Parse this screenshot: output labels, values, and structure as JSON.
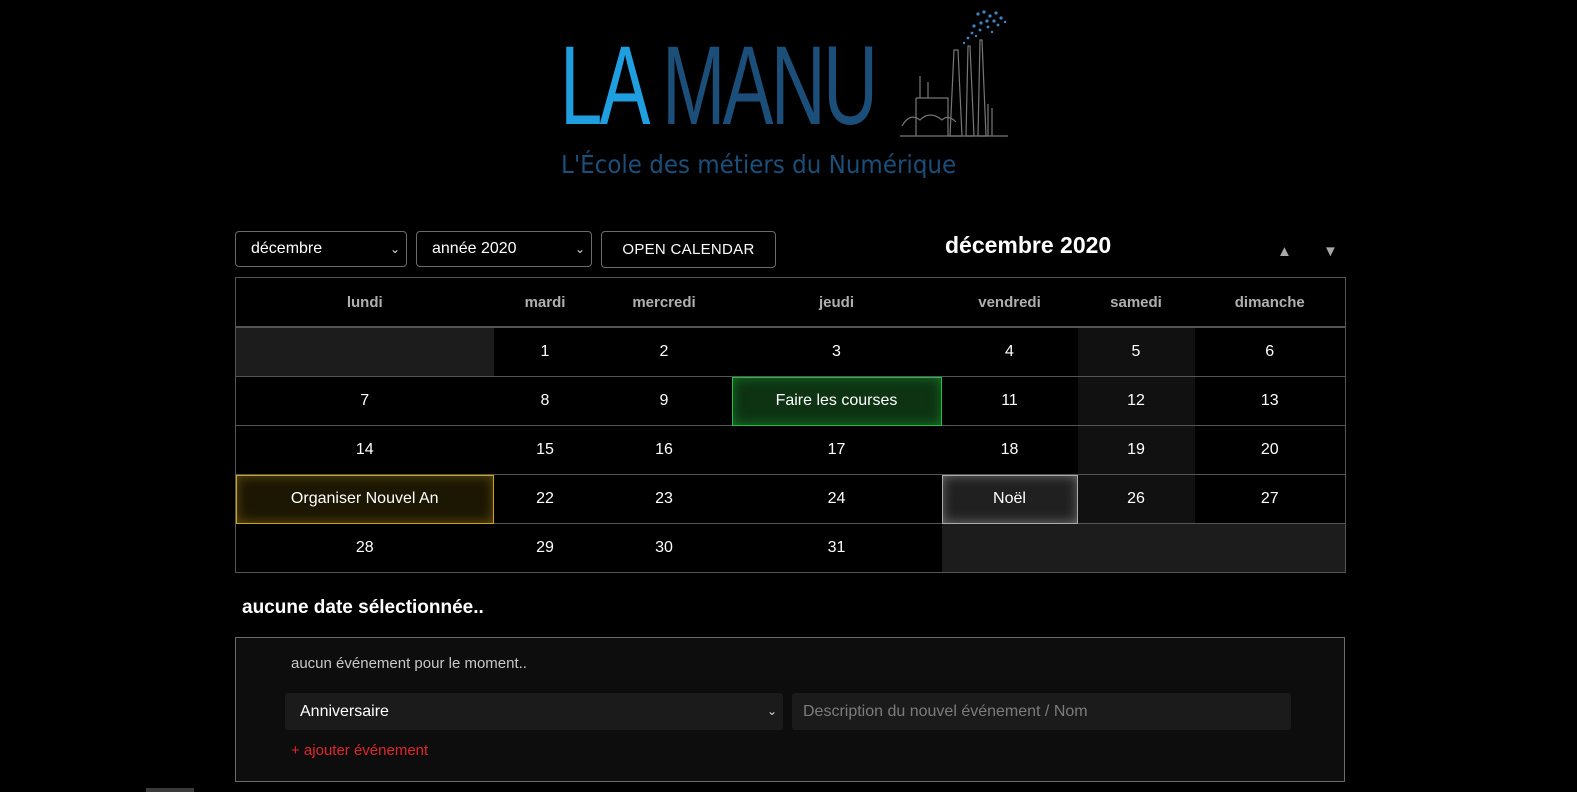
{
  "logo": {
    "title_part1": "LA",
    "title_part2": "MANU",
    "subtitle": "L'École des métiers du Numérique",
    "icon": "factory-icon"
  },
  "toolbar": {
    "month_select": "décembre",
    "year_select": "année 2020",
    "open_calendar_label": "OPEN CALENDAR",
    "month_title": "décembre 2020",
    "prev_icon": "triangle-up-icon",
    "next_icon": "triangle-down-icon"
  },
  "calendar": {
    "weekdays": [
      "lundi",
      "mardi",
      "mercredi",
      "jeudi",
      "vendredi",
      "samedi",
      "dimanche"
    ],
    "weeks": [
      [
        "",
        "1",
        "2",
        "3",
        "4",
        "5",
        "6"
      ],
      [
        "7",
        "8",
        "9",
        "Faire les courses",
        "11",
        "12",
        "13"
      ],
      [
        "14",
        "15",
        "16",
        "17",
        "18",
        "19",
        "20"
      ],
      [
        "Organiser Nouvel An",
        "22",
        "23",
        "24",
        "Noël",
        "26",
        "27"
      ],
      [
        "28",
        "29",
        "30",
        "31",
        "",
        "",
        ""
      ]
    ]
  },
  "events": {
    "selected_title": "aucune date sélectionnée..",
    "no_events_text": "aucun événement pour le moment..",
    "type_select": "Anniversaire",
    "description_placeholder": "Description du nouvel événement / Nom",
    "add_label": "+ ajouter événement"
  },
  "colors": {
    "logo_light_blue": "#1f9fe0",
    "logo_dark_blue": "#1b4e78",
    "event_green": "#2db84a",
    "event_yellow": "#c9a51b",
    "event_grey": "#aaaaaa",
    "add_red": "#e0252d"
  }
}
